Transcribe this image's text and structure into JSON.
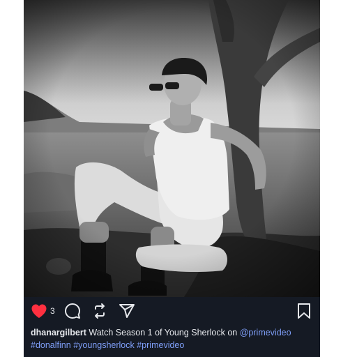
{
  "post": {
    "like_count": "3",
    "username": "dhanargilbert",
    "caption_text": "Watch Season 1 of Young Sherlock on",
    "mention": "@primevideo",
    "hashtags": [
      "#donalfinn",
      "#youngsherlock",
      "#primevideo"
    ]
  },
  "icons": {
    "like": "heart-icon",
    "comment": "comment-bubble-icon",
    "share": "repost-icon",
    "send": "paper-plane-icon",
    "bookmark": "bookmark-icon"
  },
  "colors": {
    "card_background": "#151a24",
    "like_red": "#ff3040",
    "link_blue": "#7e9ef7",
    "text": "#e6e8ec"
  }
}
